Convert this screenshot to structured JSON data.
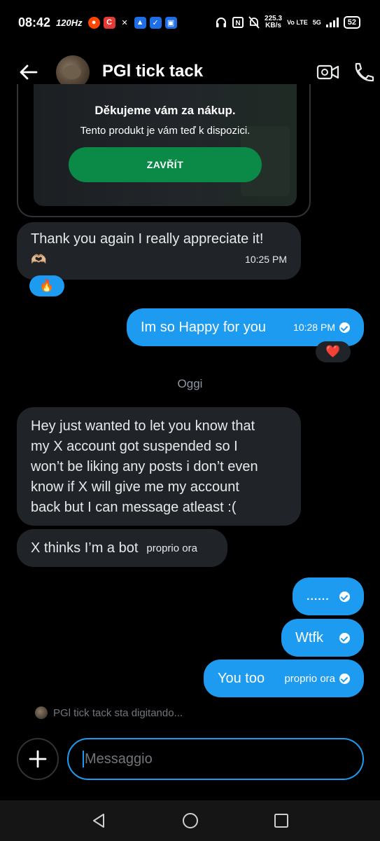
{
  "status_bar": {
    "time": "08:42",
    "refresh": "120Hz",
    "speed_value": "225.3",
    "speed_unit": "KB/s",
    "network": "Vo LTE",
    "signal": "5G",
    "battery": "52"
  },
  "header": {
    "title": "PGl tick tack"
  },
  "card": {
    "heading": "Děkujeme vám za nákup.",
    "text": "Tento produkt je vám teď k dispozici.",
    "button_label": "ZAVŘÍT"
  },
  "messages": [
    {
      "dir": "in",
      "text": "Thank you again I really appreciate it!",
      "emoji": "🫶🏼",
      "time": "10:25 PM",
      "reaction": "🔥"
    },
    {
      "dir": "out",
      "text": "Im so Happy for you",
      "time": "10:28 PM",
      "reaction": "❤️"
    },
    {
      "dir": "in",
      "lines": [
        "Hey just wanted to let you know that",
        "my X account got suspended so I",
        "won’t be liking any posts i don’t even",
        "know if X will give me my account",
        "back but I can message atleast :("
      ]
    },
    {
      "dir": "in",
      "text": "X thinks I’m a bot",
      "time": "proprio ora"
    },
    {
      "dir": "out",
      "text": "......"
    },
    {
      "dir": "out",
      "text": "Wtfk"
    },
    {
      "dir": "out",
      "text": "You too",
      "time": "proprio ora"
    }
  ],
  "day_separator": "Oggi",
  "typing_indicator": "PGl tick tack sta digitando...",
  "composer": {
    "placeholder": "Messaggio"
  },
  "colors": {
    "accent": "#1d9bf0",
    "incoming_bubble": "#202327",
    "button_green": "#0a8a46"
  }
}
